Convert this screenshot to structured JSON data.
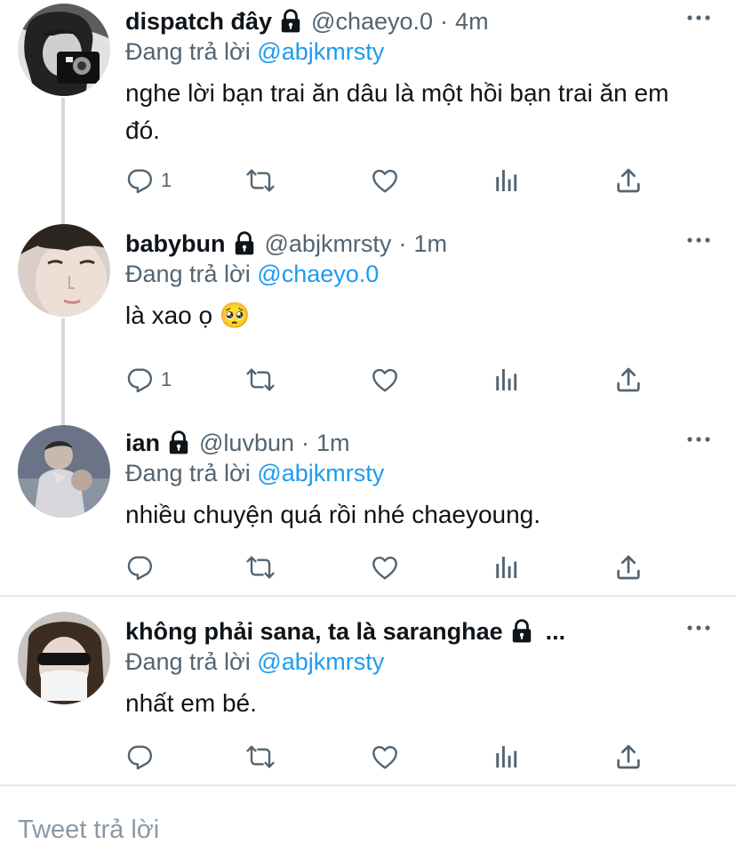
{
  "reply_prefix": "Đang trả lời",
  "tweets": [
    {
      "name": "dispatch đây",
      "handle": "@chaeyo.0",
      "sep": "·",
      "time": "4m",
      "reply_to": "@abjkmrsty",
      "text": "nghe lời bạn trai ăn dâu là một hồi bạn trai ăn em đó.",
      "reply_count": "1"
    },
    {
      "name": "babybun",
      "handle": "@abjkmrsty",
      "sep": "·",
      "time": "1m",
      "reply_to": "@chaeyo.0",
      "text": "là xao ọ",
      "emoji": "🥺",
      "reply_count": "1"
    },
    {
      "name": "ian",
      "handle": "@luvbun",
      "sep": "·",
      "time": "1m",
      "reply_to": "@abjkmrsty",
      "text": "nhiều chuyện quá rồi nhé chaeyoung.",
      "reply_count": ""
    },
    {
      "name": "không phải sana, ta là saranghae",
      "ellipsis": "...",
      "reply_to": "@abjkmrsty",
      "text": "nhất em bé.",
      "reply_count": ""
    }
  ],
  "compose": {
    "placeholder": "Tweet trả lời"
  },
  "colors": {
    "link": "#1d9bf0",
    "muted": "#536471",
    "line": "#cfd9de"
  }
}
